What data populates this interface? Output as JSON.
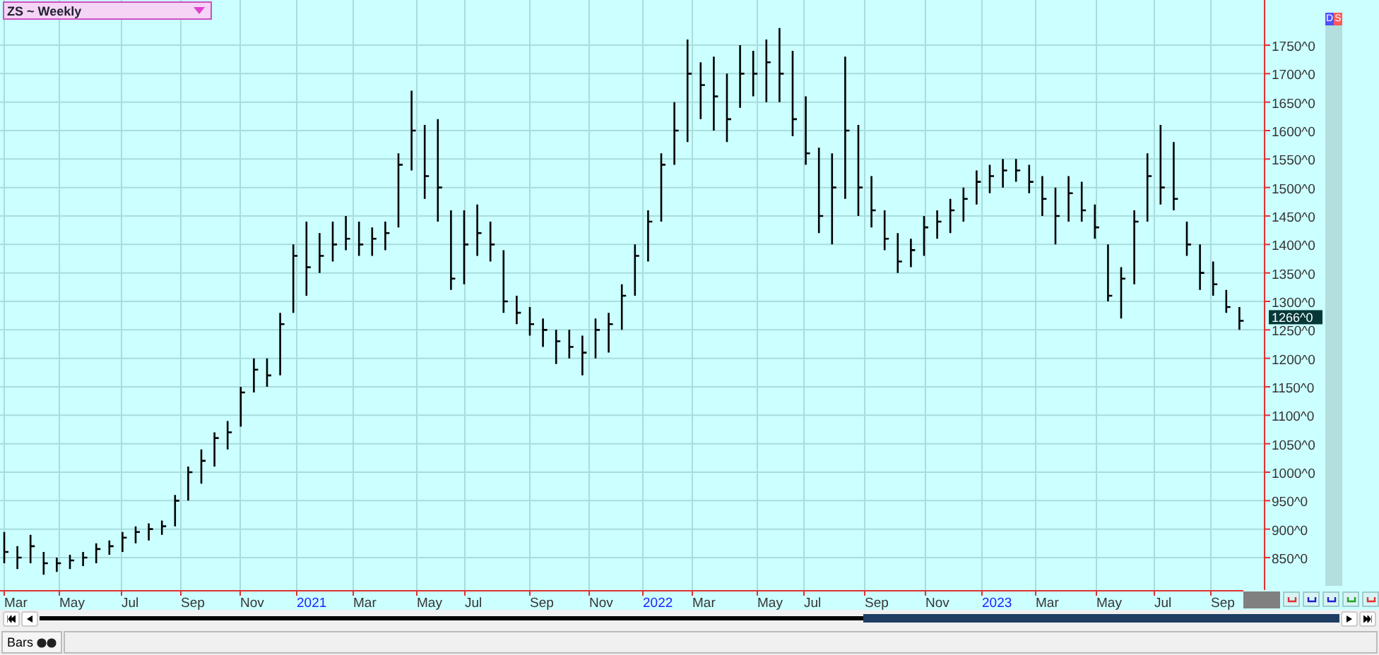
{
  "title": {
    "label": "ZS ~ Weekly"
  },
  "badges": [
    {
      "label": "D",
      "color": "#5050ff"
    },
    {
      "label": "S",
      "color": "#ff5a5a"
    }
  ],
  "price_axis": {
    "labels": [
      "1750^0",
      "1700^0",
      "1650^0",
      "1600^0",
      "1550^0",
      "1500^0",
      "1450^0",
      "1400^0",
      "1350^0",
      "1300^0",
      "1250^0",
      "1200^0",
      "1150^0",
      "1100^0",
      "1050^0",
      "1000^0",
      "950^0",
      "900^0",
      "850^0"
    ],
    "last_price": "1266^0"
  },
  "time_axis": {
    "labels": [
      {
        "label": "Mar",
        "kind": "month"
      },
      {
        "label": "May",
        "kind": "month"
      },
      {
        "label": "Jul",
        "kind": "month"
      },
      {
        "label": "Sep",
        "kind": "month"
      },
      {
        "label": "Nov",
        "kind": "month"
      },
      {
        "label": "2021",
        "kind": "year"
      },
      {
        "label": "Mar",
        "kind": "month"
      },
      {
        "label": "May",
        "kind": "month"
      },
      {
        "label": "Jul",
        "kind": "month"
      },
      {
        "label": "Sep",
        "kind": "month"
      },
      {
        "label": "Nov",
        "kind": "month"
      },
      {
        "label": "2022",
        "kind": "year"
      },
      {
        "label": "Mar",
        "kind": "month"
      },
      {
        "label": "May",
        "kind": "month"
      },
      {
        "label": "Jul",
        "kind": "month"
      },
      {
        "label": "Sep",
        "kind": "month"
      },
      {
        "label": "Nov",
        "kind": "month"
      },
      {
        "label": "2023",
        "kind": "year"
      },
      {
        "label": "Mar",
        "kind": "month"
      },
      {
        "label": "May",
        "kind": "month"
      },
      {
        "label": "Jul",
        "kind": "month"
      },
      {
        "label": "Sep",
        "kind": "month"
      }
    ]
  },
  "status_bar": {
    "tab": "Bars"
  }
}
